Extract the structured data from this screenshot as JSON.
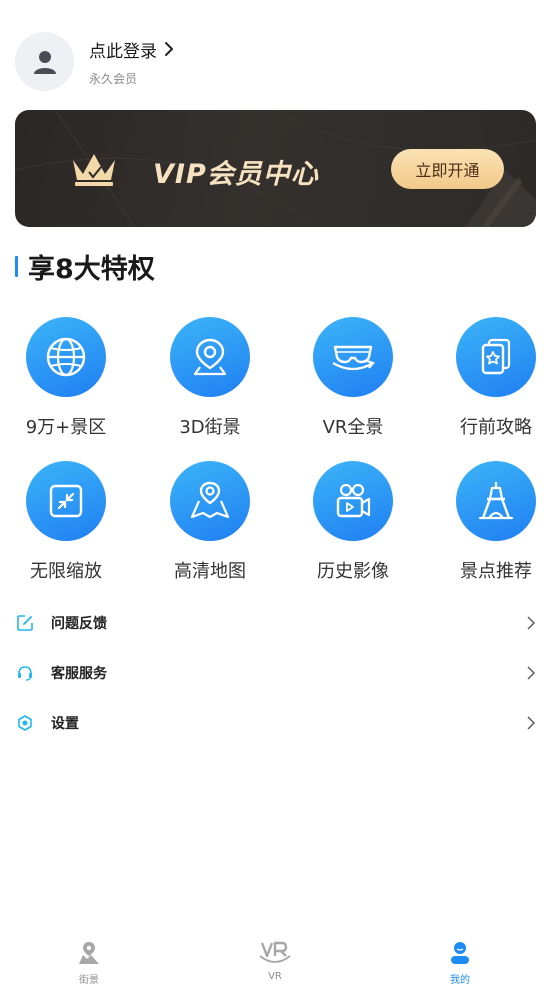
{
  "profile": {
    "login_text": "点此登录",
    "member_text": "永久会员"
  },
  "vip": {
    "title": "VIP会员中心",
    "button_label": "立即开通",
    "accent": "#f6e2c0"
  },
  "privileges": {
    "title": "享8大特权",
    "items": [
      {
        "label": "9万+景区",
        "icon": "globe-icon"
      },
      {
        "label": "3D街景",
        "icon": "location-pin-icon"
      },
      {
        "label": "VR全景",
        "icon": "vr-goggles-icon"
      },
      {
        "label": "行前攻略",
        "icon": "guide-cards-icon"
      },
      {
        "label": "无限缩放",
        "icon": "zoom-icon"
      },
      {
        "label": "高清地图",
        "icon": "map-icon"
      },
      {
        "label": "历史影像",
        "icon": "video-camera-icon"
      },
      {
        "label": "景点推荐",
        "icon": "tower-icon"
      }
    ]
  },
  "menu": {
    "items": [
      {
        "label": "问题反馈",
        "icon": "feedback-icon"
      },
      {
        "label": "客服服务",
        "icon": "headset-icon"
      },
      {
        "label": "设置",
        "icon": "settings-icon"
      }
    ]
  },
  "bottom_nav": {
    "items": [
      {
        "label": "街景",
        "icon": "streetview-icon",
        "active": false
      },
      {
        "label": "VR",
        "icon": "vr-icon",
        "active": false
      },
      {
        "label": "我的",
        "icon": "profile-icon",
        "active": true
      }
    ]
  },
  "colors": {
    "primary": "#1f8cf5",
    "gradient_start": "#3cb4f7",
    "gradient_end": "#1f7ff3"
  }
}
